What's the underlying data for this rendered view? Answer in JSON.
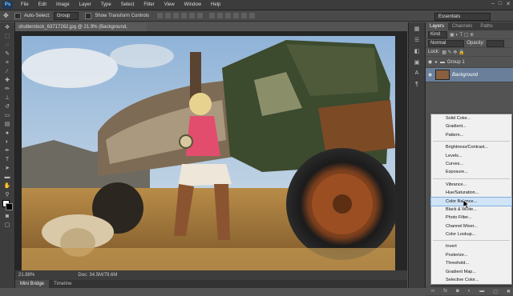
{
  "menubar": {
    "logo": "Ps",
    "items": [
      "File",
      "Edit",
      "Image",
      "Layer",
      "Type",
      "Select",
      "Filter",
      "View",
      "Window",
      "Help"
    ],
    "window_controls": [
      "–",
      "□",
      "✕"
    ]
  },
  "options": {
    "auto_select_label": "Auto-Select:",
    "auto_select_value": "Group",
    "transform_label": "Show Transform Controls",
    "workspace": "Essentials"
  },
  "document": {
    "tab_title": "shutterstock_63717262.jpg @ 21.9% (Background, RGB/8#) *",
    "zoom": "21.88%",
    "doc_info": "Doc: 34.5M/79.6M"
  },
  "bottom_tabs": [
    "Mini Bridge",
    "Timeline"
  ],
  "layers_panel": {
    "tabs": [
      "Layers",
      "Channels",
      "Paths"
    ],
    "kind": "Kind",
    "blend_mode": "Normal",
    "opacity_label": "Opacity:",
    "lock_label": "Lock:",
    "layers": [
      {
        "name": "Group 1"
      },
      {
        "name": "Background"
      }
    ]
  },
  "adjust_menu": {
    "groups": [
      [
        "Solid Color...",
        "Gradient...",
        "Pattern..."
      ],
      [
        "Brightness/Contrast...",
        "Levels...",
        "Curves...",
        "Exposure..."
      ],
      [
        "Vibrance...",
        "Hue/Saturation...",
        "Color Balance...",
        "Black & White...",
        "Photo Filter...",
        "Channel Mixer...",
        "Color Lookup..."
      ],
      [
        "Invert",
        "Posterize...",
        "Threshold...",
        "Gradient Map...",
        "Selective Color..."
      ]
    ],
    "highlighted": "Color Balance..."
  },
  "colors": {
    "menubar_bg": "#3c3c3c",
    "panel_bg": "#535353",
    "menu_bg": "#f0f0f0",
    "highlight": "#d0e4f6"
  }
}
